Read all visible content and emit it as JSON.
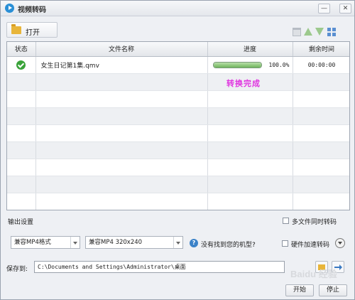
{
  "window": {
    "title": "视频转码",
    "controls": {
      "minimize": "—",
      "maximize": "□",
      "close": "✕"
    }
  },
  "toolbar": {
    "open_label": "打开"
  },
  "table": {
    "headers": {
      "status": "状态",
      "filename": "文件名称",
      "progress": "进度",
      "remaining": "剩余时间"
    },
    "rows": [
      {
        "status": "done",
        "filename": "女生日记第1集.qmv",
        "progress": 1.0,
        "progress_label": "100.0%",
        "remaining": "00:00:00"
      }
    ],
    "empty_rows": 8,
    "status_overlay": "转换完成"
  },
  "output": {
    "section_label": "输出设置",
    "multi_file_label": "多文件同时转码",
    "format_select": "兼容MP4格式",
    "resolution_select": "兼容MP4 320x240",
    "help_text": "没有找到您的机型?",
    "hw_accel_label": "硬件加速转码"
  },
  "save": {
    "label": "保存到:",
    "path": "C:\\Documents and Settings\\Administrator\\桌面"
  },
  "actions": {
    "start_label": "开始",
    "stop_label": "停止"
  },
  "watermark": "Baidu 经验",
  "colors": {
    "done": "#3aa33a",
    "overlay": "#e035e0",
    "progress": "#6fb35c"
  }
}
